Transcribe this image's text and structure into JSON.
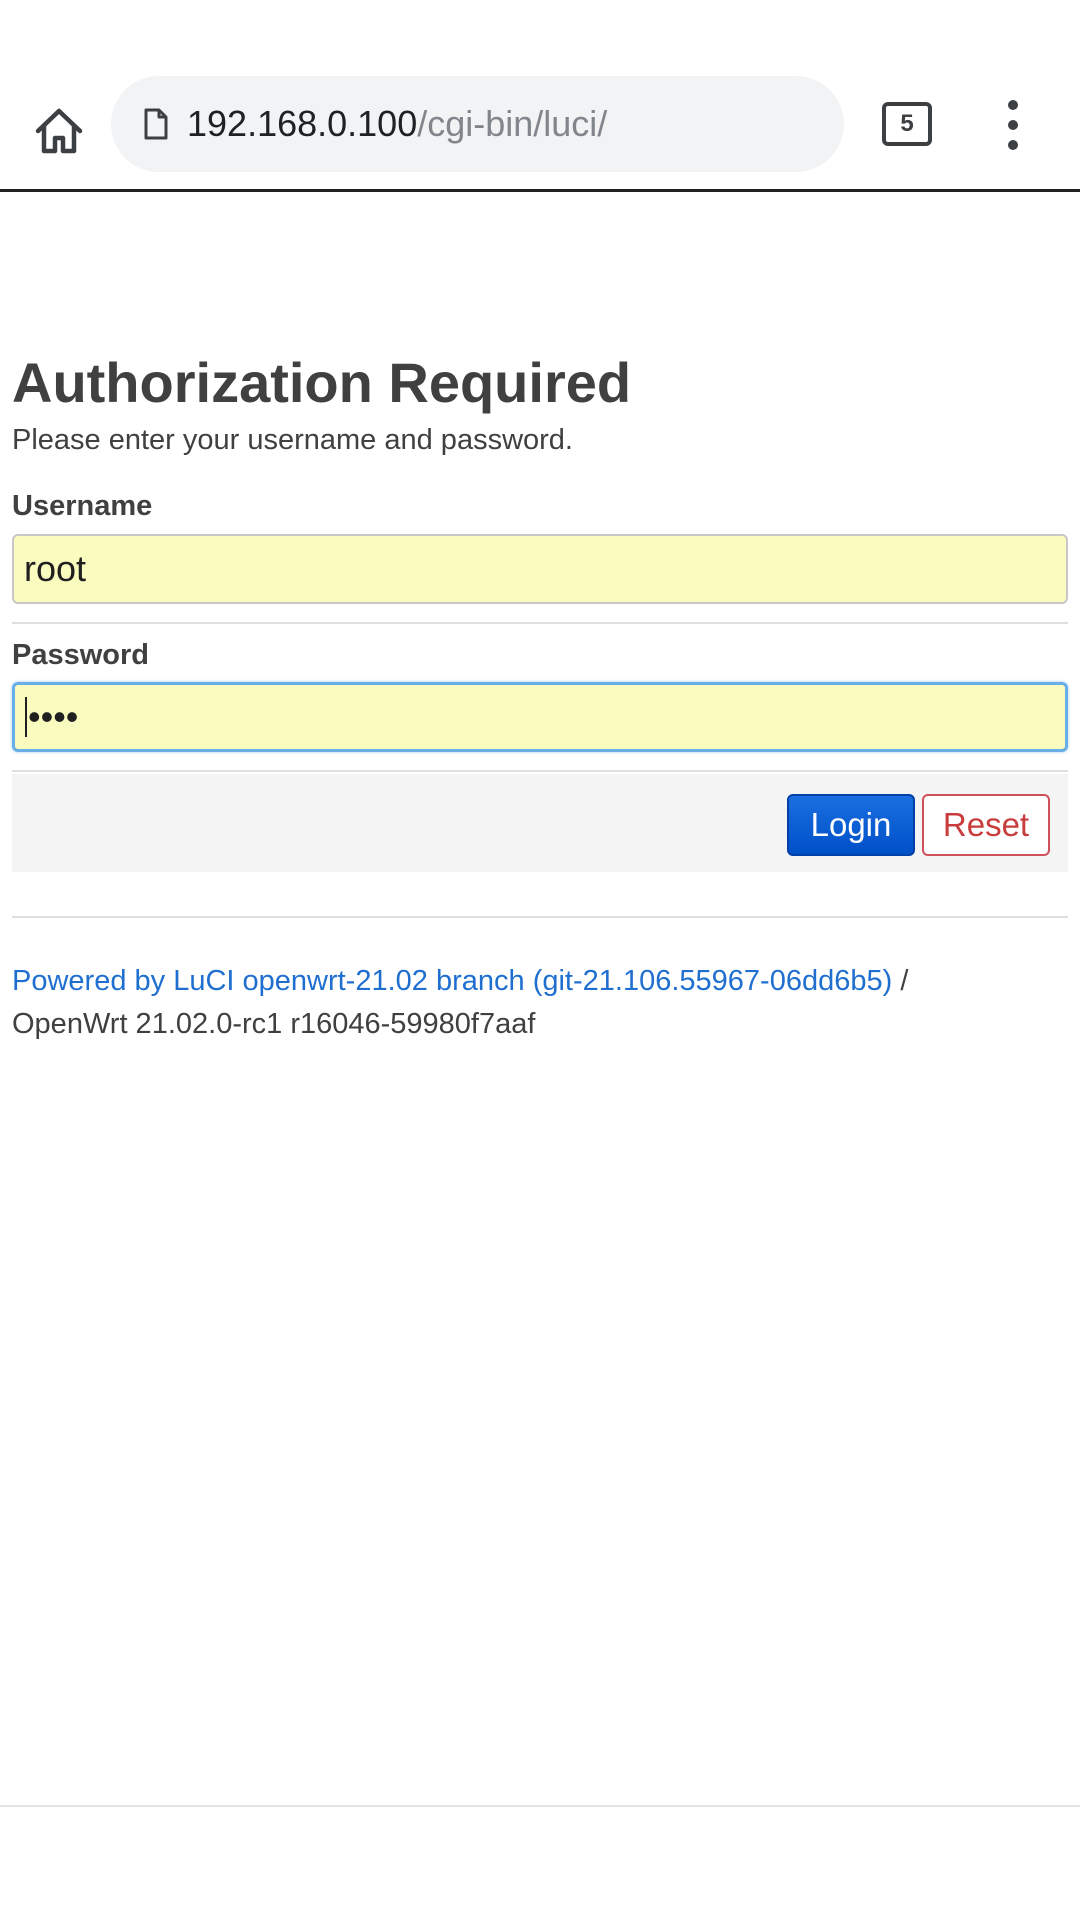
{
  "browser": {
    "url_host": "192.168.0.100",
    "url_path": "/cgi-bin/luci/",
    "tab_count": "5",
    "icons": {
      "home": "home-icon",
      "page": "page-icon",
      "tabs": "tabs-icon",
      "menu": "more-vert-icon"
    }
  },
  "page": {
    "title": "Authorization Required",
    "description": "Please enter your username and password."
  },
  "form": {
    "username_label": "Username",
    "username_value": "root",
    "password_label": "Password",
    "password_masked": "••••",
    "login_label": "Login",
    "reset_label": "Reset"
  },
  "footer": {
    "powered_link": "Powered by LuCI openwrt-21.02 branch (git-21.106.55967-06dd6b5)",
    "separator": " /",
    "version": "OpenWrt 21.02.0-rc1 r16046-59980f7aaf"
  },
  "colors": {
    "input_bg": "#fafcbf",
    "login_bg": "#0050c8",
    "reset_text": "#c83c3c",
    "link": "#1f6fd0"
  }
}
